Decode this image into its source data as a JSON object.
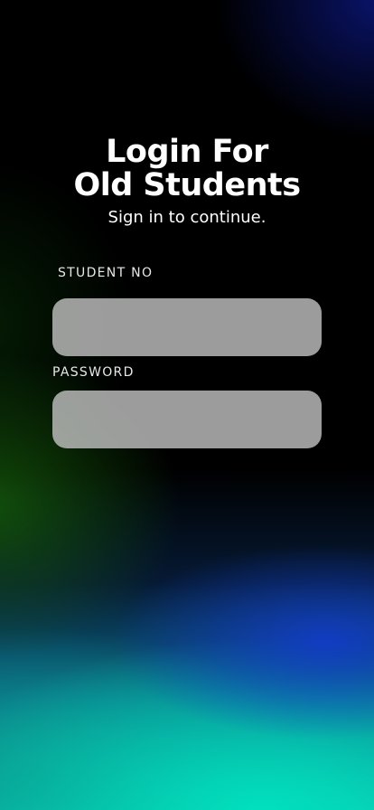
{
  "screen": {
    "title_line1": "Login For",
    "title_line2": "Old Students",
    "subtitle": "Sign in to continue."
  },
  "form": {
    "student_no": {
      "label": "STUDENT NO",
      "value": "",
      "placeholder": ""
    },
    "password": {
      "label": "PASSWORD",
      "value": "",
      "placeholder": ""
    }
  },
  "colors": {
    "text": "#ffffff",
    "label": "#e8e8e8",
    "input_background": "#bebebe",
    "background_top": "#000000",
    "background_bottom": "#10b7a8"
  }
}
